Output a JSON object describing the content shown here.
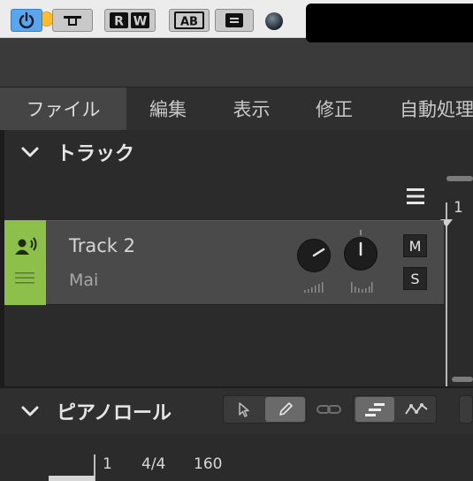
{
  "window": {
    "controls": [
      "close",
      "minimize",
      "zoom"
    ]
  },
  "toolbar": {
    "buttons": [
      {
        "name": "power",
        "icon": "power-icon",
        "active": true
      },
      {
        "name": "loop",
        "icon": "loop-icon"
      },
      {
        "name": "record-write",
        "label": "RW"
      },
      {
        "name": "ab",
        "label": "AB"
      },
      {
        "name": "menu",
        "icon": "minus-box-icon"
      }
    ]
  },
  "menu": {
    "items": [
      "ファイル",
      "編集",
      "表示",
      "修正",
      "自動処理"
    ],
    "active_index": 0
  },
  "tracks_section": {
    "title": "トラック",
    "ruler_start": "1",
    "track": {
      "name": "Track 2",
      "subtitle": "Mai",
      "color": "#8dc04b",
      "mute_label": "M",
      "solo_label": "S"
    }
  },
  "piano_roll": {
    "title": "ピアノロール",
    "ruler": {
      "bar": "1",
      "time_signature": "4/4",
      "tempo": "160"
    }
  },
  "colors": {
    "accent": "#5aa6ee",
    "track_color": "#8dc04b"
  }
}
